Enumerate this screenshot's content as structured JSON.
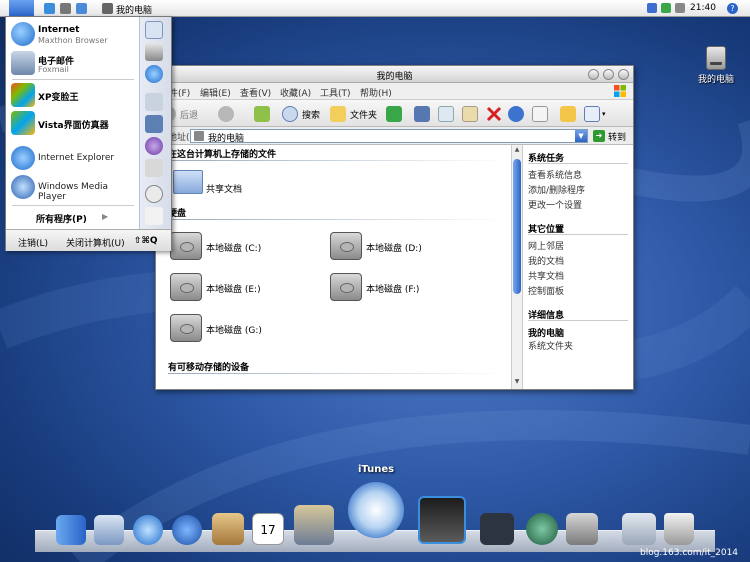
{
  "menubar": {
    "title": "我的电脑",
    "clock": "21:40",
    "help": "?"
  },
  "desktop": {
    "my_computer_label": "我的电脑"
  },
  "start_menu": {
    "items": [
      {
        "title": "Internet",
        "subtitle": "Maxthon Browser"
      },
      {
        "title": "电子邮件",
        "subtitle": "Foxmail"
      },
      {
        "title": "XP变脸王",
        "subtitle": ""
      },
      {
        "title": "Vista界面仿真器",
        "subtitle": ""
      },
      {
        "title": "Internet Explorer",
        "subtitle": ""
      },
      {
        "title": "Windows Media Player",
        "subtitle": ""
      }
    ],
    "all_programs": "所有程序(P)",
    "log_off": "注销(L)",
    "shut_down": "关闭计算机(U)",
    "shortcut": "⇧⌘Q"
  },
  "explorer": {
    "title": "我的电脑",
    "menu": [
      "文件(F)",
      "编辑(E)",
      "查看(V)",
      "收藏(A)",
      "工具(T)",
      "帮助(H)"
    ],
    "toolbar": {
      "back": "后退",
      "search": "搜索",
      "folders": "文件夹"
    },
    "address": {
      "label": "地址(D)",
      "value": "我的电脑",
      "go": "转到"
    },
    "sections": {
      "stored_files": "在这台计算机上存储的文件",
      "hard_disks": "硬盘",
      "removable": "有可移动存储的设备"
    },
    "shared_docs": "共享文档",
    "drives": [
      "本地磁盘 (C:)",
      "本地磁盘 (D:)",
      "本地磁盘 (E:)",
      "本地磁盘 (F:)",
      "本地磁盘 (G:)"
    ],
    "side": {
      "system_tasks": {
        "title": "系统任务",
        "links": [
          "查看系统信息",
          "添加/删除程序",
          "更改一个设置"
        ]
      },
      "other_places": {
        "title": "其它位置",
        "links": [
          "网上邻居",
          "我的文档",
          "共享文档",
          "控制面板"
        ]
      },
      "details": {
        "title": "详细信息",
        "name": "我的电脑",
        "type": "系统文件夹"
      }
    }
  },
  "dock": {
    "hover_label": "iTunes",
    "calendar_day": "17"
  },
  "watermark": "blog.163.com/it_2014",
  "colors": {
    "accent": "#2e63c5",
    "desktop": "#2f5aa8"
  }
}
